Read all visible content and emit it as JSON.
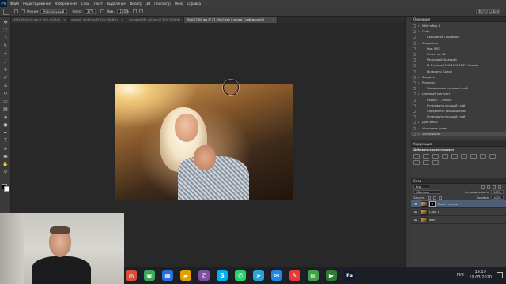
{
  "app": {
    "logo": "Ps"
  },
  "menu": [
    "Файл",
    "Редактирование",
    "Изображение",
    "Слои",
    "Текст",
    "Выделение",
    "Фильтр",
    "3D",
    "Просмотр",
    "Окно",
    "Справка"
  ],
  "options": {
    "mode_label": "Режим:",
    "mode_value": "Нормальный",
    "opacity_label": "Непр.:",
    "opacity_value": "37%",
    "flow_label": "Наж.:",
    "flow_value": "100%",
    "workspace": "Фотография"
  },
  "tabs": [
    {
      "label": "49313985916.jpg @ 50% (RGB/8)",
      "active": false
    },
    {
      "label": "AdobeF_mKxF.jpg @ 50% (RGB/8)",
      "active": false
    },
    {
      "label": "Scribble4RM_uk1.jpg @ 50% (RGB/8)",
      "active": false
    },
    {
      "label": "7bGJ2J7QJh.jpg @ 27,4% (Слой 1 копия, Слой-маска/8)",
      "active": true
    }
  ],
  "history": {
    "title": "Операции",
    "rows": [
      {
        "text": "Мой набор 1",
        "tri": "▾",
        "sel": false
      },
      {
        "text": "Софт",
        "tri": "▾",
        "sel": false
      },
      {
        "text": "Объединить видимые",
        "tri": "",
        "sel": false
      },
      {
        "text": "Сохранить",
        "tri": "▾",
        "sel": false
      },
      {
        "text": "Как: JPEG",
        "tri": "",
        "sel": false
      },
      {
        "text": "Качество: 12",
        "tri": "",
        "sel": false
      },
      {
        "text": "Растровый: Базовый",
        "tri": "",
        "sel": false
      },
      {
        "text": "В: D:\\Фото\\2020\\2020.02.27 Ксюша",
        "tri": "",
        "sel": false
      },
      {
        "text": "Включить: Копия",
        "tri": "",
        "sel": false
      },
      {
        "text": "Закрыть",
        "tri": "▸",
        "sel": false
      },
      {
        "text": "Резкость",
        "tri": "▾",
        "sel": false
      },
      {
        "text": "Скопировать на новый слой",
        "tri": "",
        "sel": false
      },
      {
        "text": "Цветовой контраст",
        "tri": "▸",
        "sel": false
      },
      {
        "text": "Радиус: 1,5 пикс.",
        "tri": "",
        "sel": false
      },
      {
        "text": "Установить текущий слой",
        "tri": "",
        "sel": false
      },
      {
        "text": "Определить текущий слой",
        "tri": "",
        "sel": false
      },
      {
        "text": "Установить текущий слой",
        "tri": "",
        "sel": false
      },
      {
        "text": "Для сети 2",
        "tri": "▸",
        "sel": false
      },
      {
        "text": "Нажатие в дыма",
        "tri": "▸",
        "sel": false
      },
      {
        "text": "Экспозиция",
        "tri": "▸",
        "sel": true
      }
    ]
  },
  "adjustments": {
    "title": "Коррекция",
    "subtitle": "Добавить корректировку"
  },
  "layers": {
    "title": "Слои",
    "kind_label": "Вид",
    "blend_value": "Обычные",
    "opacity_label": "Непрозрачность:",
    "opacity_value": "100%",
    "lock_label": "Закреп.:",
    "fill_label": "Заливка:",
    "fill_value": "100%",
    "items": [
      {
        "name": "Слой 1 копия",
        "mask": true,
        "sel": true
      },
      {
        "name": "Слой 1",
        "mask": false,
        "sel": false
      },
      {
        "name": "Фон",
        "mask": false,
        "sel": false
      }
    ]
  },
  "taskbar": {
    "icons": [
      {
        "name": "chrome-icon",
        "color": "#dd4b39",
        "glyph": "◎"
      },
      {
        "name": "notes-icon",
        "color": "#3aa757",
        "glyph": "▣"
      },
      {
        "name": "photos-icon",
        "color": "#2a6fdb",
        "glyph": "▦"
      },
      {
        "name": "files-icon",
        "color": "#e0a000",
        "glyph": "▰"
      },
      {
        "name": "viber-icon",
        "color": "#7b519d",
        "glyph": "✆"
      },
      {
        "name": "skype-icon",
        "color": "#00aff0",
        "glyph": "S"
      },
      {
        "name": "whatsapp-icon",
        "color": "#25d366",
        "glyph": "✆"
      },
      {
        "name": "telegram-icon",
        "color": "#2aa3d8",
        "glyph": "➤"
      },
      {
        "name": "mail-icon",
        "color": "#1e88e5",
        "glyph": "✉"
      },
      {
        "name": "paint-icon",
        "color": "#e53935",
        "glyph": "✎"
      },
      {
        "name": "app-icon",
        "color": "#43a047",
        "glyph": "▤"
      },
      {
        "name": "media-icon",
        "color": "#2e7d32",
        "glyph": "▶"
      },
      {
        "name": "photoshop-icon",
        "color": "#0f1b2c",
        "glyph": "Ps"
      }
    ],
    "lang": "РУС",
    "time": "19:19",
    "date": "19.03.2020"
  }
}
